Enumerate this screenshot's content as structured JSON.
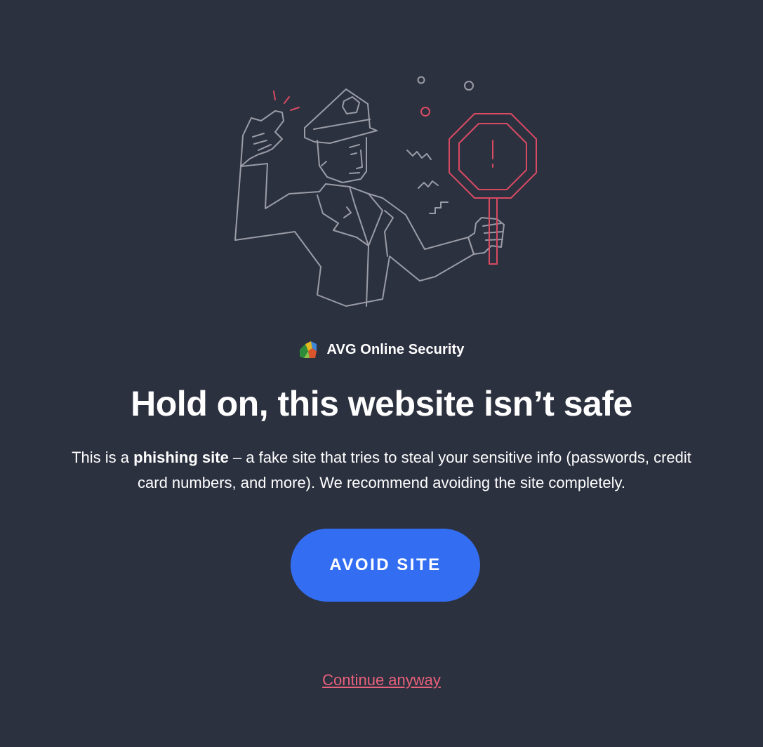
{
  "colors": {
    "background": "#2c3140",
    "accent_button": "#336ef2",
    "danger_link": "#e8617a",
    "illustration_line": "#9a9ca6",
    "illustration_warning": "#d94a63"
  },
  "illustration": {
    "icon": "police-officer-stop-sign-icon"
  },
  "brand": {
    "logo_icon": "avg-logo-icon",
    "name": "AVG Online Security"
  },
  "headline": "Hold on, this website isn’t safe",
  "description": {
    "prefix": "This is a ",
    "emphasis": "phishing site",
    "suffix": " – a fake site that tries to steal your sensitive info (passwords, credit card numbers, and more). We recommend avoiding the site completely."
  },
  "actions": {
    "avoid_label": "AVOID SITE",
    "continue_label": "Continue anyway"
  }
}
